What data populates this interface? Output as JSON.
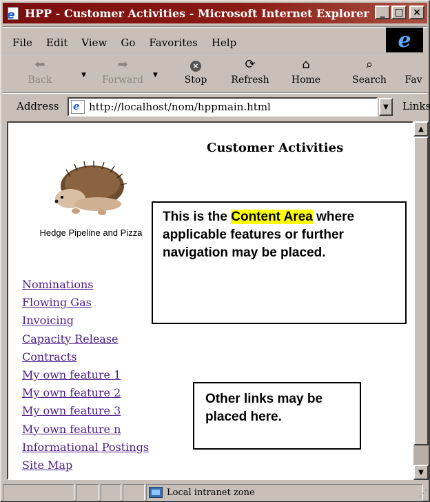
{
  "window": {
    "title": "HPP - Customer Activities - Microsoft Internet Explorer",
    "buttons": {
      "minimize": "_",
      "maximize": "□",
      "close": "×"
    }
  },
  "menu": [
    "File",
    "Edit",
    "View",
    "Go",
    "Favorites",
    "Help"
  ],
  "toolbar": {
    "back": "Back",
    "forward": "Forward",
    "stop": "Stop",
    "refresh": "Refresh",
    "home": "Home",
    "search": "Search",
    "favorites": "Fav"
  },
  "address": {
    "label": "Address",
    "url": "http://localhost/nom/hppmain.html",
    "links_label": "Links"
  },
  "page": {
    "title": "Customer Activities",
    "logo_caption": "Hedge Pipeline and Pizza",
    "nav_links": [
      "Nominations",
      "Flowing Gas",
      "Invoicing",
      "Capacity Release",
      "Contracts",
      "My own feature 1",
      "My own feature 2",
      "My own feature 3",
      "My own feature n",
      "Informational Postings",
      "Site Map"
    ],
    "content_box": {
      "prefix": "This is the ",
      "highlight": "Content Area",
      "suffix": " where applicable features or further navigation may be placed."
    },
    "links_box": "Other links may be placed here."
  },
  "status": {
    "zone": "Local intranet zone"
  },
  "colors": {
    "titlebar": "#7a0e0e",
    "link": "#4b1e8a",
    "highlight": "#ffff00"
  }
}
